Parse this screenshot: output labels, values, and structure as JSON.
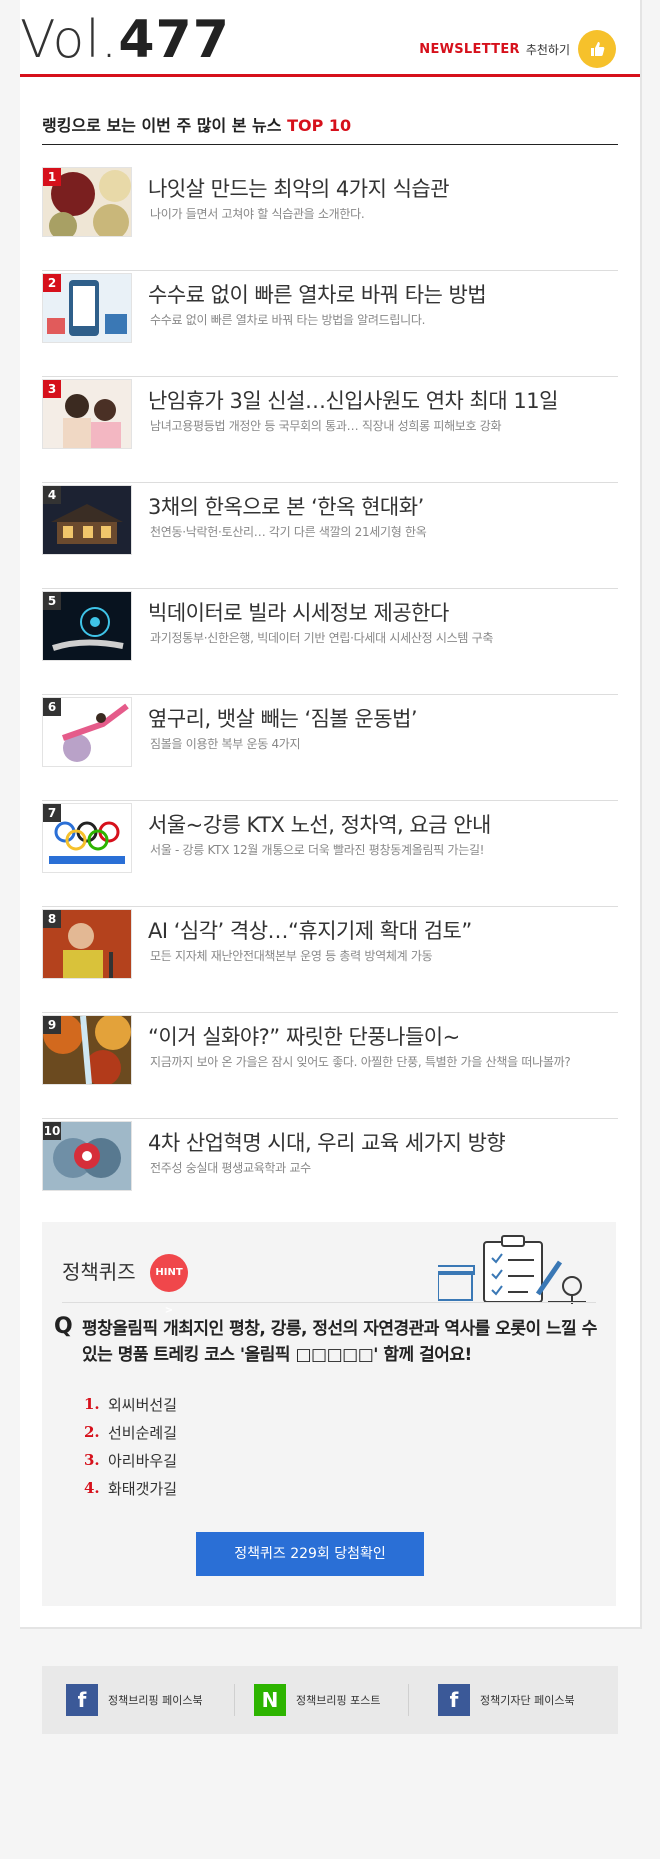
{
  "header": {
    "vol_prefix": "Vol.",
    "vol_number": "477",
    "newsletter_label": "NEWSLETTER",
    "recommend_label": "추천하기"
  },
  "ranking": {
    "title_text": "랭킹으로 보는 이번 주 많이 본 뉴스",
    "title_highlight": "TOP 10",
    "items": [
      {
        "rank": "1",
        "title": "나잇살 만드는 최악의 4가지 식습관",
        "sub": "나이가 들면서 고쳐야 할 식습관을 소개한다."
      },
      {
        "rank": "2",
        "title": "수수료 없이 빠른 열차로 바꿔 타는 방법",
        "sub": "수수료 없이 빠른 열차로 바꿔 타는 방법을 알려드립니다."
      },
      {
        "rank": "3",
        "title": "난임휴가 3일 신설…신입사원도 연차 최대 11일",
        "sub": "남녀고용평등법 개정안 등 국무회의 통과… 직장내 성희롱 피해보호 강화"
      },
      {
        "rank": "4",
        "title": "3채의 한옥으로 본 ‘한옥 현대화’",
        "sub": "천연동·낙락헌·토산리… 각기 다른 색깔의 21세기형 한옥"
      },
      {
        "rank": "5",
        "title": "빅데이터로 빌라 시세정보 제공한다",
        "sub": "과기정통부·신한은행, 빅데이터 기반 연립·다세대 시세산정 시스템 구축"
      },
      {
        "rank": "6",
        "title": "옆구리, 뱃살 빼는 ‘짐볼 운동법’",
        "sub": "짐볼을 이용한 복부 운동 4가지"
      },
      {
        "rank": "7",
        "title": "서울~강릉 KTX 노선, 정차역, 요금 안내",
        "sub": "서울 - 강릉 KTX 12월 개통으로 더욱 빨라진 평창동계올림픽 가는길!"
      },
      {
        "rank": "8",
        "title": "AI ‘심각’ 격상…“휴지기제 확대 검토”",
        "sub": "모든 지자체 재난안전대책본부 운영 등 총력 방역체계 가동"
      },
      {
        "rank": "9",
        "title": "“이거 실화야?” 짜릿한 단풍나들이~",
        "sub": "지금까지 보아 온 가을은 잠시 잊어도 좋다. 아찔한 단풍, 특별한 가을 산책을 떠나볼까?"
      },
      {
        "rank": "10",
        "title": "4차 산업혁명 시대, 우리 교육 세가지 방향",
        "sub": "전주성 숭실대 평생교육학과 교수"
      }
    ]
  },
  "quiz": {
    "title": "정책퀴즈",
    "hint": "HINT >",
    "q_mark": "Q",
    "question": "평창올림픽 개최지인 평창, 강릉, 정선의 자연경관과 역사를 오롯이 느낄 수 있는 명품 트레킹 코스 '올림픽 □□□□□' 함께 걸어요!",
    "options": [
      {
        "n": "1.",
        "text": "외씨버선길"
      },
      {
        "n": "2.",
        "text": "선비순례길"
      },
      {
        "n": "3.",
        "text": "아리바우길"
      },
      {
        "n": "4.",
        "text": "화태갯가길"
      }
    ],
    "button": "정책퀴즈 229회 당첨확인"
  },
  "footer": {
    "items": [
      {
        "icon": "f",
        "label": "정책브리핑 페이스북"
      },
      {
        "icon": "N",
        "label": "정책브리핑 포스트"
      },
      {
        "icon": "f",
        "label": "정책기자단 페이스북"
      }
    ]
  },
  "colors": {
    "accent_red": "#d6101b",
    "quiz_button": "#2a6fd6",
    "facebook": "#3b5998",
    "naver": "#2db400",
    "like_yellow": "#f6c12b"
  }
}
